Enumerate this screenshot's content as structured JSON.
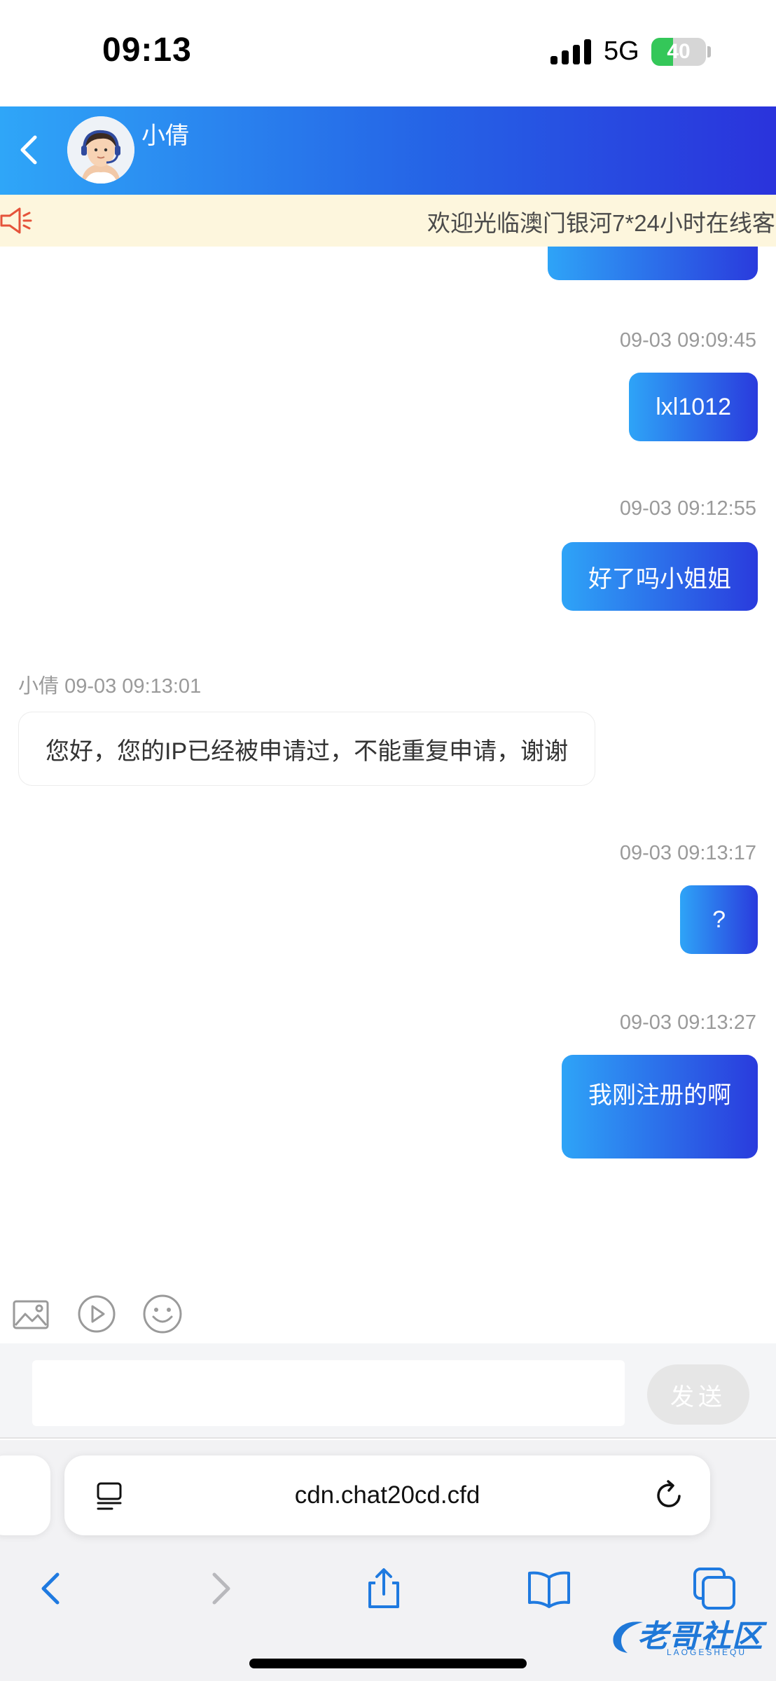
{
  "status_bar": {
    "time": "09:13",
    "network": "5G",
    "battery": "40",
    "battery_level": 0.4
  },
  "header": {
    "agent_name": "小倩"
  },
  "notice": {
    "text": "欢迎光临澳门银河7*24小时在线客"
  },
  "messages": [
    {
      "direction": "out",
      "time": "09-03 09:09:45",
      "text": "lxl1012"
    },
    {
      "direction": "out",
      "time": "09-03 09:12:55",
      "text": "好了吗小姐姐"
    },
    {
      "direction": "in",
      "sender": "小倩",
      "time": "09-03 09:13:01",
      "text": "您好，您的IP已经被申请过，不能重复申请，谢谢"
    },
    {
      "direction": "out",
      "time": "09-03 09:13:17",
      "text": "?"
    },
    {
      "direction": "out",
      "time": "09-03 09:13:27",
      "text": "我刚注册的啊"
    }
  ],
  "composer": {
    "input_value": "",
    "send_label": "发送"
  },
  "browser": {
    "url": "cdn.chat20cd.cfd"
  },
  "watermark": {
    "title": "老哥社区",
    "subtitle": "LAOGESHEQU"
  }
}
